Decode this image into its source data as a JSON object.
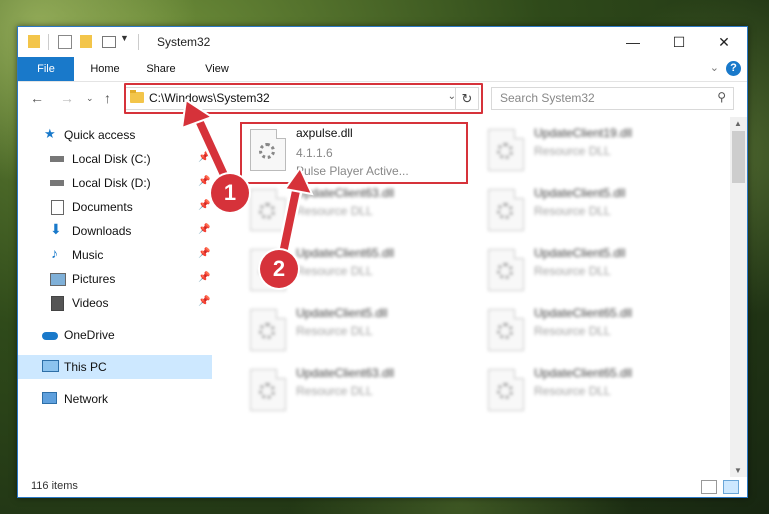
{
  "window": {
    "title": "System32",
    "controls": [
      "—",
      "☐",
      "✕"
    ]
  },
  "ribbon": {
    "tabs": [
      "File",
      "Home",
      "Share",
      "View"
    ],
    "help": "?"
  },
  "navigation": {
    "address_path": "C:\\Windows\\System32",
    "search_placeholder": "Search System32"
  },
  "sidebar": {
    "items": [
      {
        "label": "Quick access",
        "icon": "star-icon",
        "pinned": false
      },
      {
        "label": "Local Disk (C:)",
        "icon": "drive-icon",
        "pinned": true
      },
      {
        "label": "Local Disk (D:)",
        "icon": "drive-icon",
        "pinned": true
      },
      {
        "label": "Documents",
        "icon": "document-icon",
        "pinned": true
      },
      {
        "label": "Downloads",
        "icon": "download-icon",
        "pinned": true
      },
      {
        "label": "Music",
        "icon": "music-icon",
        "pinned": true
      },
      {
        "label": "Pictures",
        "icon": "pictures-icon",
        "pinned": true
      },
      {
        "label": "Videos",
        "icon": "videos-icon",
        "pinned": true
      },
      {
        "label": "OneDrive",
        "icon": "cloud-icon",
        "pinned": false
      },
      {
        "label": "This PC",
        "icon": "computer-icon",
        "pinned": false,
        "selected": true
      },
      {
        "label": "Network",
        "icon": "network-icon",
        "pinned": false
      }
    ]
  },
  "files": [
    {
      "name": "axpulse.dll",
      "version": "4.1.1.6",
      "description": "Pulse Player Active...",
      "highlighted": true
    },
    {
      "name": "UpdateClient19.dll",
      "type": "Resource DLL"
    },
    {
      "name": "UpdateClient63.dll",
      "type": "Resource DLL"
    },
    {
      "name": "UpdateClient5.dll",
      "type": "Resource DLL"
    },
    {
      "name": "UpdateClient65.dll",
      "type": "Resource DLL"
    },
    {
      "name": "UpdateClient5.dll",
      "type": "Resource DLL"
    },
    {
      "name": "UpdateClient5.dll",
      "type": "Resource DLL"
    },
    {
      "name": "UpdateClient65.dll",
      "type": "Resource DLL"
    },
    {
      "name": "UpdateClient63.dll",
      "type": "Resource DLL"
    },
    {
      "name": "UpdateClient65.dll",
      "type": "Resource DLL"
    }
  ],
  "status": {
    "item_count": "116 items"
  },
  "annotations": {
    "step1": "1",
    "step2": "2",
    "highlight_color": "#d6323a"
  }
}
